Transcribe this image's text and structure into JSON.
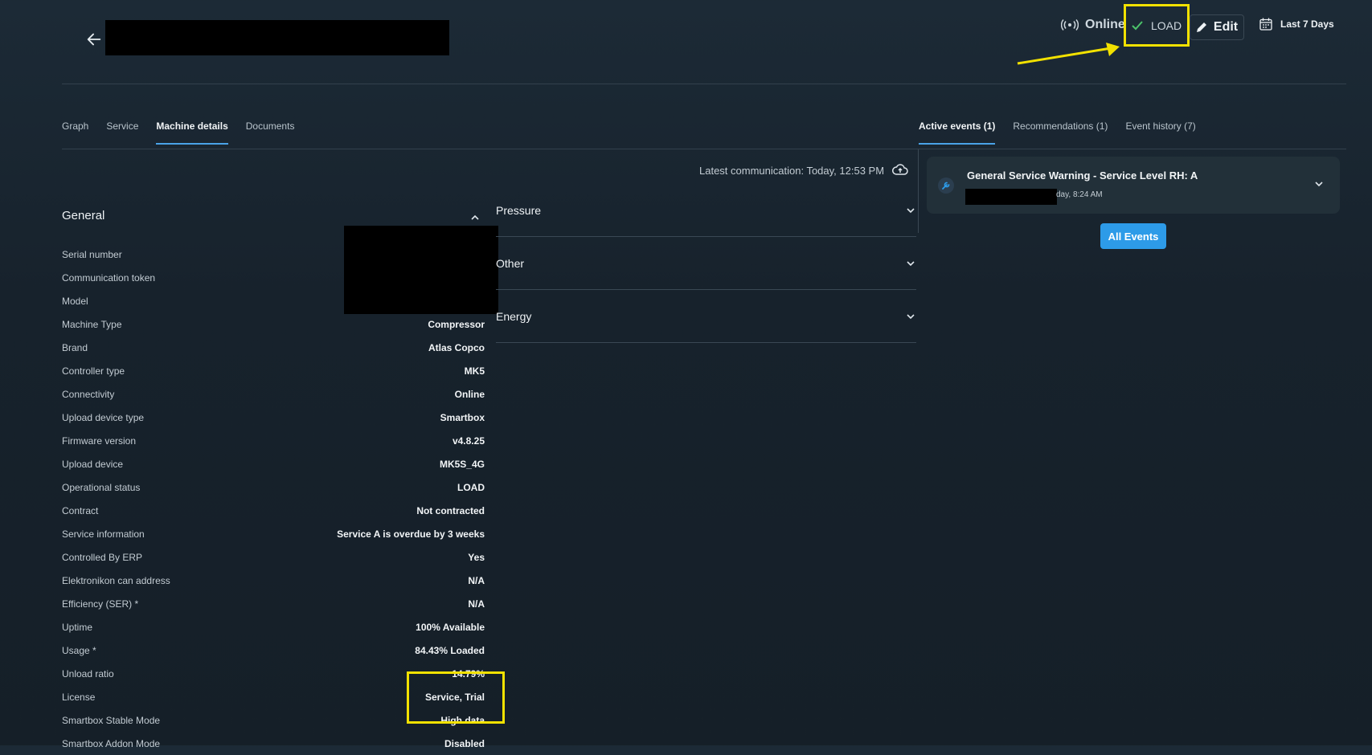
{
  "header": {
    "status": "Online",
    "operational_badge": "LOAD",
    "edit_label": "Edit",
    "date_range": "Last 7 Days"
  },
  "tabs": [
    {
      "label": "Graph"
    },
    {
      "label": "Service"
    },
    {
      "label": "Machine details"
    },
    {
      "label": "Documents"
    }
  ],
  "event_tabs": [
    {
      "label": "Active events (1)"
    },
    {
      "label": "Recommendations (1)"
    },
    {
      "label": "Event history (7)"
    }
  ],
  "latest_communication": "Latest communication: Today, 12:53 PM",
  "general": {
    "title": "General",
    "rows": [
      {
        "label": "Serial number",
        "value": ""
      },
      {
        "label": "Communication token",
        "value": ""
      },
      {
        "label": "Model",
        "value": ""
      },
      {
        "label": "Machine Type",
        "value": "Compressor"
      },
      {
        "label": "Brand",
        "value": "Atlas Copco"
      },
      {
        "label": "Controller type",
        "value": "MK5"
      },
      {
        "label": "Connectivity",
        "value": "Online"
      },
      {
        "label": "Upload device type",
        "value": "Smartbox"
      },
      {
        "label": "Firmware version",
        "value": "v4.8.25"
      },
      {
        "label": "Upload device",
        "value": "MK5S_4G"
      },
      {
        "label": "Operational status",
        "value": "LOAD"
      },
      {
        "label": "Contract",
        "value": "Not contracted"
      },
      {
        "label": "Service information",
        "value": "Service A is overdue by 3 weeks"
      },
      {
        "label": "Controlled By ERP",
        "value": "Yes"
      },
      {
        "label": "Elektronikon can address",
        "value": "N/A"
      },
      {
        "label": "Efficiency (SER) *",
        "value": "N/A"
      },
      {
        "label": "Uptime",
        "value": "100% Available"
      },
      {
        "label": "Usage *",
        "value": "84.43% Loaded"
      },
      {
        "label": "Unload ratio",
        "value": "14.79%"
      },
      {
        "label": "License",
        "value": "Service, Trial"
      },
      {
        "label": "Smartbox Stable Mode",
        "value": "High data"
      },
      {
        "label": "Smartbox Addon Mode",
        "value": "Disabled"
      }
    ]
  },
  "accordions": [
    {
      "label": "Pressure"
    },
    {
      "label": "Other"
    },
    {
      "label": "Energy"
    }
  ],
  "event": {
    "title": "General Service Warning - Service Level RH: A",
    "time": "day, 8:24 AM"
  },
  "all_events_label": "All Events",
  "colors": {
    "accent": "#2d9be8",
    "highlight": "#f2e100",
    "background": "#1a2530"
  }
}
